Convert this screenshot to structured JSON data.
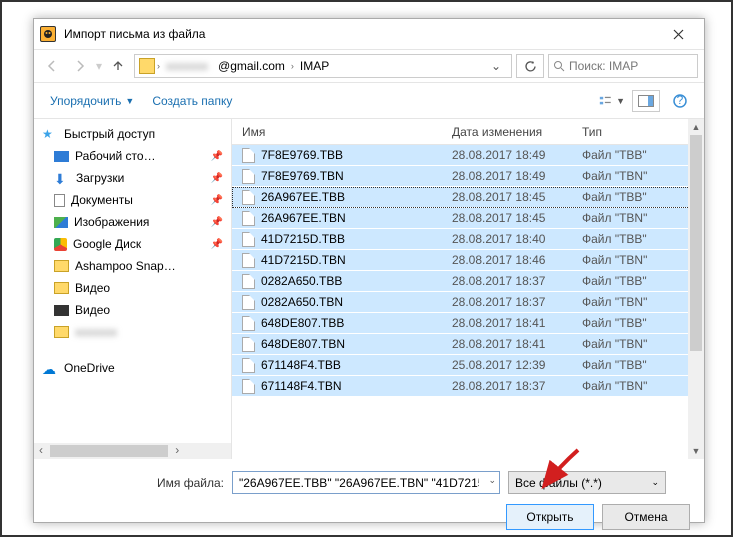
{
  "title": "Импорт письма из файла",
  "breadcrumb": {
    "mid": "@gmail.com",
    "last": "IMAP"
  },
  "search_placeholder": "Поиск: IMAP",
  "toolbar": {
    "organize": "Упорядочить",
    "newfolder": "Создать папку"
  },
  "sidebar": {
    "quick": "Быстрый доступ",
    "items": [
      {
        "label": "Рабочий сто…",
        "pin": true
      },
      {
        "label": "Загрузки",
        "pin": true
      },
      {
        "label": "Документы",
        "pin": true
      },
      {
        "label": "Изображения",
        "pin": true
      },
      {
        "label": "Google Диск",
        "pin": true
      },
      {
        "label": "Ashampoo Snap…",
        "pin": false
      },
      {
        "label": "Видео",
        "pin": false
      },
      {
        "label": "Видео",
        "pin": false
      },
      {
        "label": "",
        "pin": false
      }
    ],
    "onedrive": "OneDrive"
  },
  "columns": {
    "name": "Имя",
    "date": "Дата изменения",
    "type": "Тип"
  },
  "files": [
    {
      "name": "7F8E9769.TBB",
      "date": "28.08.2017 18:49",
      "type": "Файл \"TBB\""
    },
    {
      "name": "7F8E9769.TBN",
      "date": "28.08.2017 18:49",
      "type": "Файл \"TBN\""
    },
    {
      "name": "26A967EE.TBB",
      "date": "28.08.2017 18:45",
      "type": "Файл \"TBB\""
    },
    {
      "name": "26A967EE.TBN",
      "date": "28.08.2017 18:45",
      "type": "Файл \"TBN\""
    },
    {
      "name": "41D7215D.TBB",
      "date": "28.08.2017 18:40",
      "type": "Файл \"TBB\""
    },
    {
      "name": "41D7215D.TBN",
      "date": "28.08.2017 18:46",
      "type": "Файл \"TBN\""
    },
    {
      "name": "0282A650.TBB",
      "date": "28.08.2017 18:37",
      "type": "Файл \"TBB\""
    },
    {
      "name": "0282A650.TBN",
      "date": "28.08.2017 18:37",
      "type": "Файл \"TBN\""
    },
    {
      "name": "648DE807.TBB",
      "date": "28.08.2017 18:41",
      "type": "Файл \"TBB\""
    },
    {
      "name": "648DE807.TBN",
      "date": "28.08.2017 18:41",
      "type": "Файл \"TBN\""
    },
    {
      "name": "671148F4.TBB",
      "date": "25.08.2017 12:39",
      "type": "Файл \"TBB\""
    },
    {
      "name": "671148F4.TBN",
      "date": "28.08.2017 18:37",
      "type": "Файл \"TBN\""
    }
  ],
  "filename_label": "Имя файла:",
  "filename_value": "\"26A967EE.TBB\" \"26A967EE.TBN\" \"41D7215",
  "filter": "Все файлы (*.*)",
  "open": "Открыть",
  "cancel": "Отмена"
}
